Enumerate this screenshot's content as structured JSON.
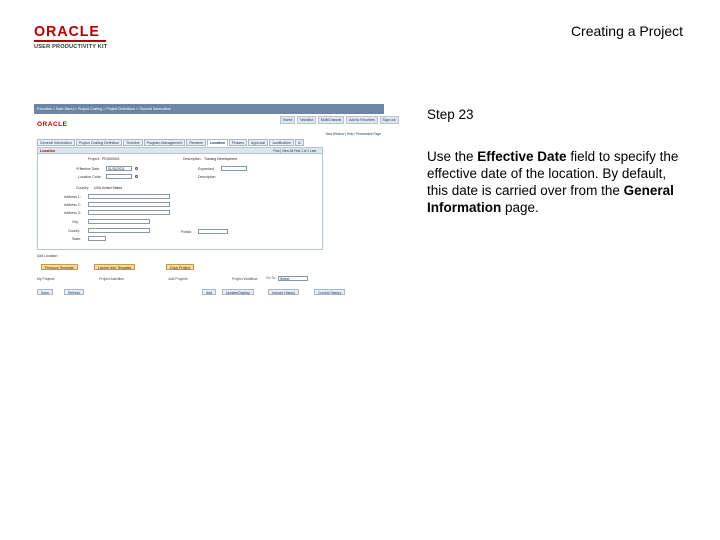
{
  "logo": {
    "brand": "ORACLE",
    "subtitle": "USER PRODUCTIVITY KIT"
  },
  "page_title": "Creating a Project",
  "step": {
    "title": "Step 23",
    "text_parts": [
      {
        "text": "Use the ",
        "bold": false
      },
      {
        "text": "Effective Date",
        "bold": true
      },
      {
        "text": " field to specify the effective date of the location. By default, this date is carried over from the ",
        "bold": false
      },
      {
        "text": "General Information",
        "bold": true
      },
      {
        "text": " page.",
        "bold": false
      }
    ]
  },
  "screenshot": {
    "breadcrumb": "Favorites  >  Main Menu  >  Project Costing  >  Project Definitions  >  General Information",
    "logo": "ORACLE",
    "top_links": [
      "Home",
      "Worklist",
      "MultiChannel",
      "Add to Favorites",
      "Sign out"
    ],
    "util_links": "New Window | Help | Personalize Page",
    "tabs": [
      {
        "label": "General Information",
        "active": false
      },
      {
        "label": "Project Costing Definition",
        "active": false
      },
      {
        "label": "Timeline",
        "active": false
      },
      {
        "label": "Program Management",
        "active": false
      },
      {
        "label": "Rename",
        "active": false
      },
      {
        "label": "Location",
        "active": true
      },
      {
        "label": "Phases",
        "active": false
      },
      {
        "label": "Approval",
        "active": false
      },
      {
        "label": "Justification",
        "active": false
      },
      {
        "label": "IC",
        "active": false
      }
    ],
    "panel": {
      "title": "Location",
      "nav": "Find | View All    First  1 of 1  Last",
      "project_label": "Project:",
      "project_value": "PRJ000001",
      "desc_label": "Description:",
      "desc_value": "Training Development",
      "effective_date_label": "*Effective Date:",
      "effective_date_value": "01/01/2011",
      "location_label": "Location Code:",
      "description_label": "Description",
      "expanded_label": "Expanded",
      "country_label": "Country:",
      "country_value": "USA  United States",
      "address_labels": [
        "Address 1:",
        "Address 2:",
        "Address 3:",
        "City:",
        "County:",
        "State:"
      ],
      "postal_label": "Postal:"
    },
    "add_location": "Add Location",
    "buttons": [
      "Previous Template",
      "Launch Into Template",
      "Copy Project"
    ],
    "footer": [
      "My Projects",
      "Project Activities",
      "Add Projects",
      "Project Workflow"
    ],
    "goto_label": "Go To:",
    "goto_value": "Select",
    "bottom_buttons": [
      "Save",
      "Refresh",
      "Add",
      "Update/Display",
      "Include History",
      "Correct History"
    ]
  }
}
